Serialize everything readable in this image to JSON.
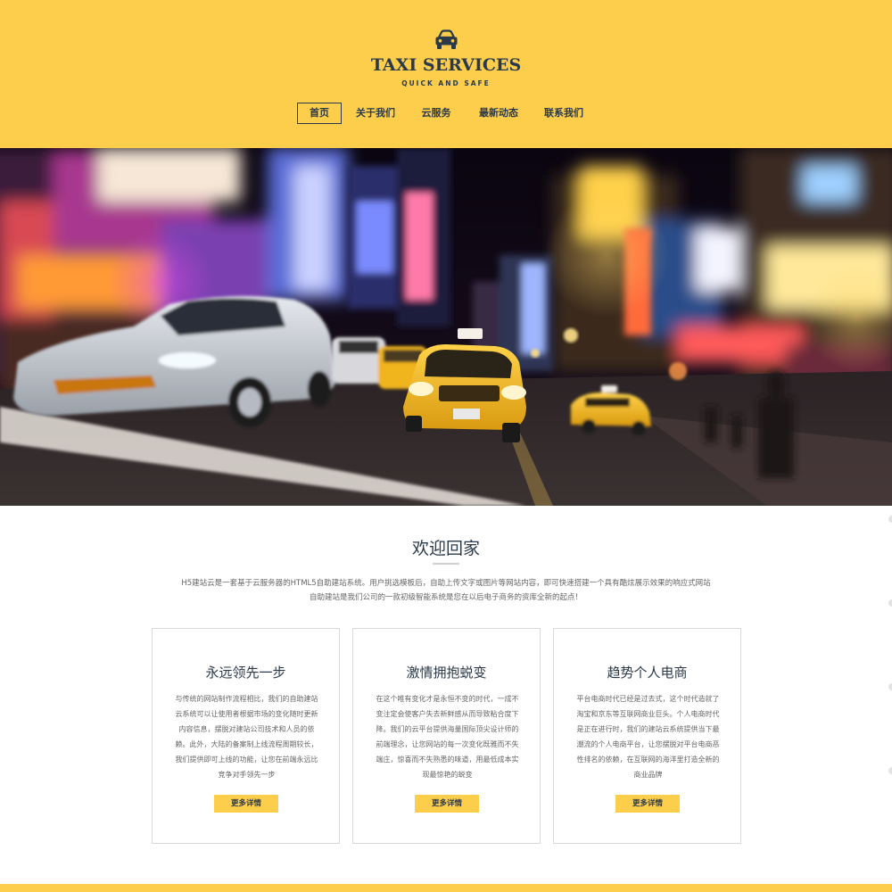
{
  "header": {
    "brand_title": "TAXI SERVICES",
    "brand_subtitle": "QUICK AND SAFE",
    "nav": [
      {
        "label": "首页",
        "active": true
      },
      {
        "label": "关于我们",
        "active": false
      },
      {
        "label": "云服务",
        "active": false
      },
      {
        "label": "最新动态",
        "active": false
      },
      {
        "label": "联系我们",
        "active": false
      }
    ]
  },
  "colors": {
    "accent": "#fdcd4c",
    "text_dark": "#2b3a4a",
    "body_text": "#666666",
    "border": "#d9d9d9"
  },
  "icons": {
    "logo": "car-icon"
  },
  "welcome": {
    "title": "欢迎回家",
    "line1": "H5建站云是一套基于云服务器的HTML5自助建站系统。用户挑选模板后，自助上传文字或图片等网站内容，即可快速搭建一个具有酷炫展示效果的响应式网站",
    "line2": "自助建站是我们公司的一款初级智能系统是您在以后电子商务的资库全新的起点！"
  },
  "cards": [
    {
      "title": "永远领先一步",
      "text": "与传统的网站制作流程相比，我们的自助建站云系统可以让使用者根据市场的变化随时更新内容信息，摆脱对建站公司技术和人员的依赖。此外，大陆的备案制上线流程周期较长，我们提供即可上线的功能，让您在前端永远比竞争对手领先一步",
      "button": "更多详情"
    },
    {
      "title": "激情拥抱蜕变",
      "text": "在这个唯有变化才是永恒不变的时代，一成不变注定会使客户失去新鲜感从而导致粘合度下降。我们的云平台提供海量国际顶尖设计师的前端理念，让您网站的每一次变化既雅而不失端庄，惊喜而不失熟悉的味道，用最低成本实现最惊艳的蜕变",
      "button": "更多详情"
    },
    {
      "title": "趋势个人电商",
      "text": "平台电商时代已经是过去式，这个时代造就了淘宝和京东等互联网商业巨头。个人电商时代是正在进行时，我们的建站云系统提供当下最潮流的个人电商平台，让您摆脱对平台电商恶性排名的依赖，在互联网的海洋里打造全新的商业品牌",
      "button": "更多详情"
    }
  ]
}
